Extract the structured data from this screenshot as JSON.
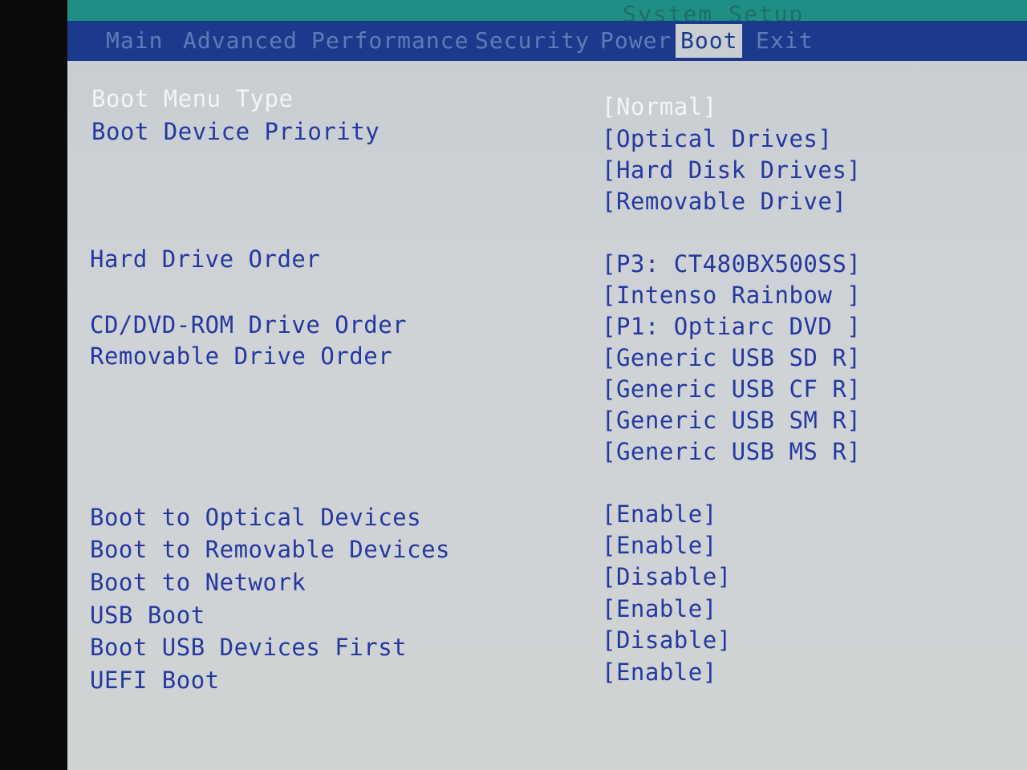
{
  "window": {
    "title": "System Setup"
  },
  "tabs": [
    {
      "label": "Main"
    },
    {
      "label": "Advanced"
    },
    {
      "label": "Performance"
    },
    {
      "label": "Security"
    },
    {
      "label": "Power"
    },
    {
      "label": "Boot"
    },
    {
      "label": "Exit"
    }
  ],
  "boot": {
    "menu_type": {
      "label": "Boot Menu Type",
      "value": "[Normal]"
    },
    "device_priority": {
      "label": "Boot Device Priority",
      "values": [
        "[Optical Drives]",
        "[Hard Disk Drives]",
        "[Removable Drive]"
      ]
    },
    "hard_drive_order": {
      "label": "Hard Drive Order",
      "values": [
        "[P3: CT480BX500SS]",
        "[Intenso Rainbow ]"
      ]
    },
    "cd_dvd_order": {
      "label": "CD/DVD-ROM Drive Order",
      "values": [
        "[P1: Optiarc DVD ]"
      ]
    },
    "removable_order": {
      "label": "Removable Drive Order",
      "values": [
        "[Generic USB SD R]",
        "[Generic USB CF R]",
        "[Generic USB SM R]",
        "[Generic USB MS R]"
      ]
    },
    "options": [
      {
        "label": "Boot to Optical Devices",
        "value": "[Enable]"
      },
      {
        "label": "Boot to Removable Devices",
        "value": "[Enable]"
      },
      {
        "label": "Boot to Network",
        "value": "[Disable]"
      },
      {
        "label": "USB Boot",
        "value": "[Enable]"
      },
      {
        "label": "Boot USB Devices First",
        "value": "[Disable]"
      },
      {
        "label": "UEFI Boot",
        "value": "[Enable]"
      }
    ]
  },
  "colors": {
    "title_bar": "#1f8f86",
    "menu_bar": "#1b3a8c",
    "text": "#2438a0",
    "highlight_text": "#f2f4f7",
    "background": "#cfd3d6"
  }
}
